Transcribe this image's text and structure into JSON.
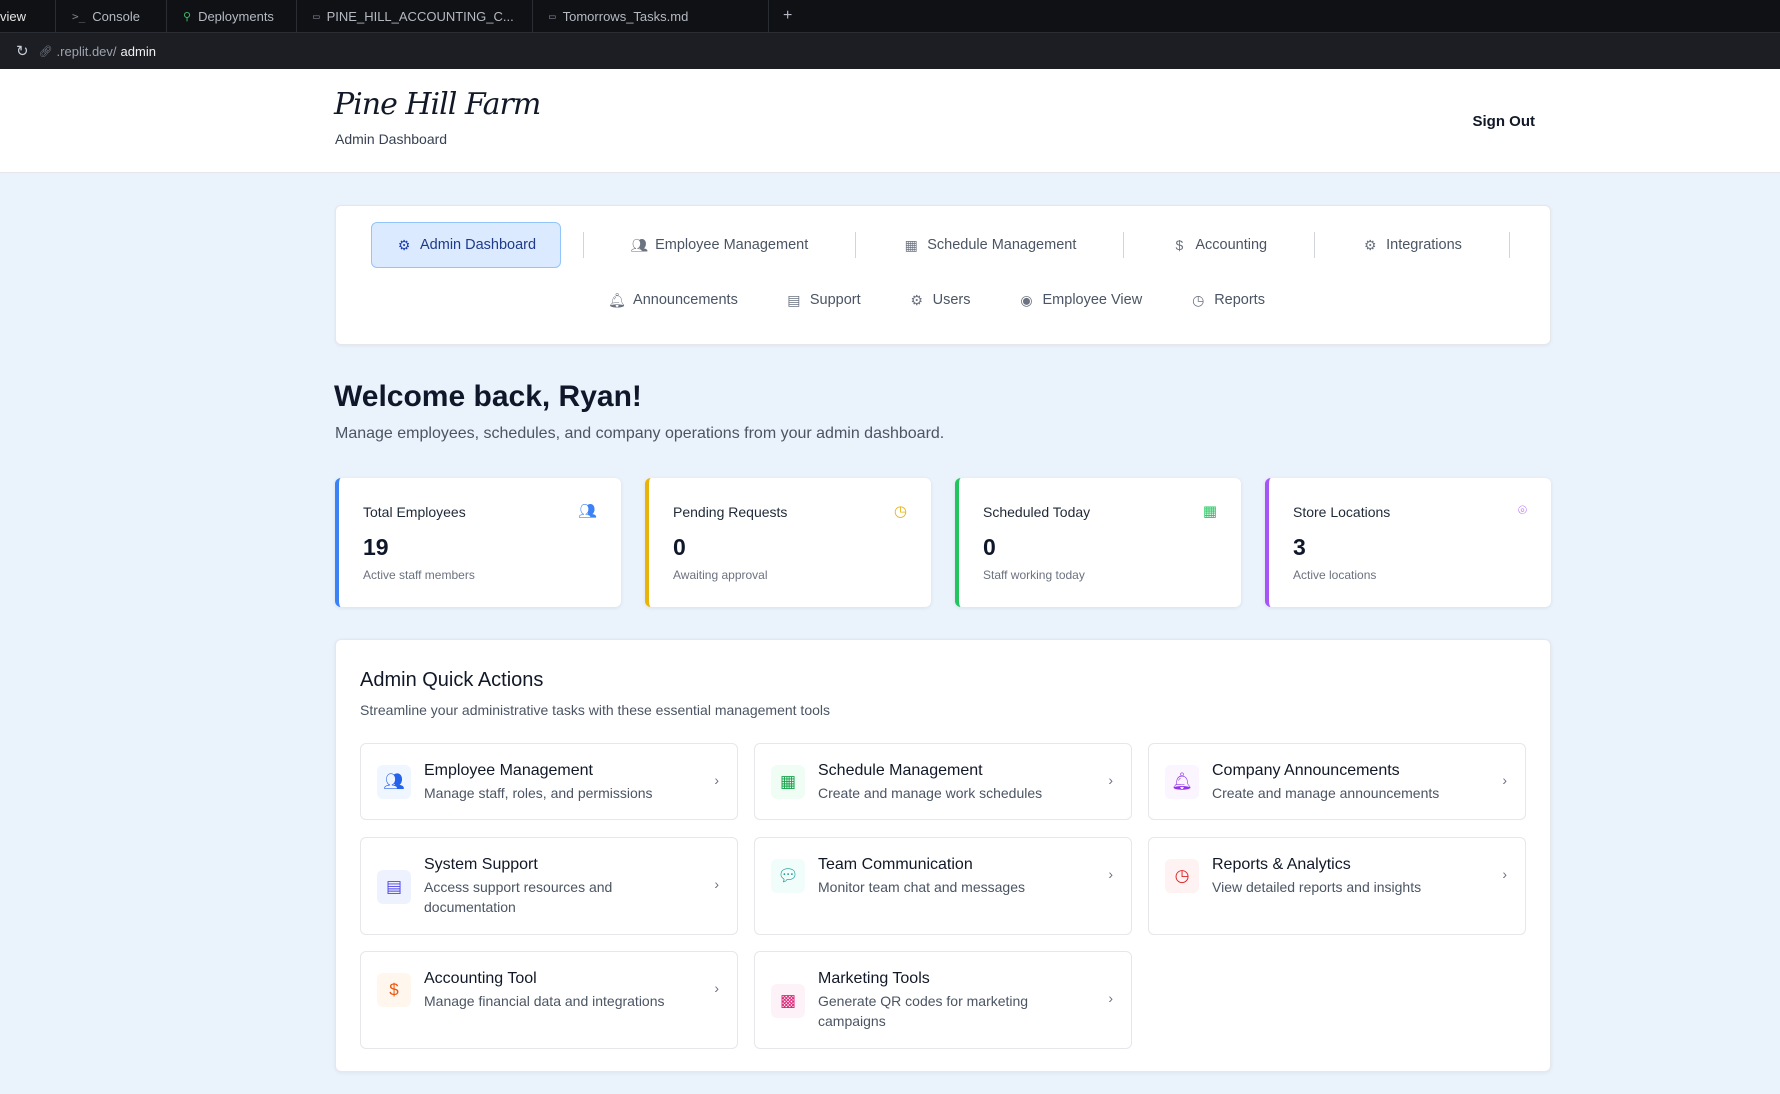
{
  "browser": {
    "tabs": [
      {
        "label": "view",
        "icon": ""
      },
      {
        "label": "Console",
        "icon": ">_"
      },
      {
        "label": "Deployments",
        "icon": "deploy-icon"
      },
      {
        "label": "PINE_HILL_ACCOUNTING_C...",
        "icon": "file-icon"
      },
      {
        "label": "Tomorrows_Tasks.md",
        "icon": "file-icon"
      }
    ],
    "new_tab": "+",
    "url_prefix": ".replit.dev/",
    "url_path": "admin"
  },
  "header": {
    "logo": "Pine Hill Farm",
    "subtitle": "Admin Dashboard",
    "sign_out": "Sign Out"
  },
  "nav": {
    "row1": [
      {
        "label": "Admin Dashboard",
        "icon": "gear-icon",
        "active": true
      },
      {
        "label": "Employee Management",
        "icon": "users-icon"
      },
      {
        "label": "Schedule Management",
        "icon": "calendar-icon"
      },
      {
        "label": "Accounting",
        "icon": "dollar-icon"
      },
      {
        "label": "Integrations",
        "icon": "gear-icon"
      }
    ],
    "row2": [
      {
        "label": "Announcements",
        "icon": "bell-icon"
      },
      {
        "label": "Support",
        "icon": "document-icon"
      },
      {
        "label": "Users",
        "icon": "gear-icon"
      },
      {
        "label": "Employee View",
        "icon": "eye-icon"
      },
      {
        "label": "Reports",
        "icon": "clock-icon"
      }
    ]
  },
  "welcome": {
    "title": "Welcome back, Ryan!",
    "subtitle": "Manage employees, schedules, and company operations from your admin dashboard."
  },
  "stats": [
    {
      "label": "Total Employees",
      "value": "19",
      "note": "Active staff members",
      "icon": "users-icon",
      "color": "#3b82f6"
    },
    {
      "label": "Pending Requests",
      "value": "0",
      "note": "Awaiting approval",
      "icon": "clock-icon",
      "color": "#eab308"
    },
    {
      "label": "Scheduled Today",
      "value": "0",
      "note": "Staff working today",
      "icon": "calendar-icon",
      "color": "#22c55e"
    },
    {
      "label": "Store Locations",
      "value": "3",
      "note": "Active locations",
      "icon": "map-pin-icon",
      "color": "#a855f7"
    }
  ],
  "quick_actions": {
    "title": "Admin Quick Actions",
    "subtitle": "Streamline your administrative tasks with these essential management tools",
    "items": [
      {
        "title": "Employee Management",
        "desc": "Manage staff, roles, and permissions",
        "icon": "users-icon",
        "color": "#2563eb",
        "bg": "#eff6ff"
      },
      {
        "title": "Schedule Management",
        "desc": "Create and manage work schedules",
        "icon": "calendar-icon",
        "color": "#16a34a",
        "bg": "#f0fdf4"
      },
      {
        "title": "Company Announcements",
        "desc": "Create and manage announcements",
        "icon": "bell-icon",
        "color": "#9333ea",
        "bg": "#faf5ff"
      },
      {
        "title": "System Support",
        "desc": "Access support resources and documentation",
        "icon": "document-icon",
        "color": "#4f46e5",
        "bg": "#eef2ff"
      },
      {
        "title": "Team Communication",
        "desc": "Monitor team chat and messages",
        "icon": "chat-icon",
        "color": "#0d9488",
        "bg": "#f0fdfa"
      },
      {
        "title": "Reports & Analytics",
        "desc": "View detailed reports and insights",
        "icon": "clock-icon",
        "color": "#dc2626",
        "bg": "#fef2f2"
      },
      {
        "title": "Accounting Tool",
        "desc": "Manage financial data and integrations",
        "icon": "dollar-icon",
        "color": "#ea580c",
        "bg": "#fff7ed"
      },
      {
        "title": "Marketing Tools",
        "desc": "Generate QR codes for marketing campaigns",
        "icon": "qr-code-icon",
        "color": "#db2777",
        "bg": "#fdf2f8"
      }
    ]
  }
}
